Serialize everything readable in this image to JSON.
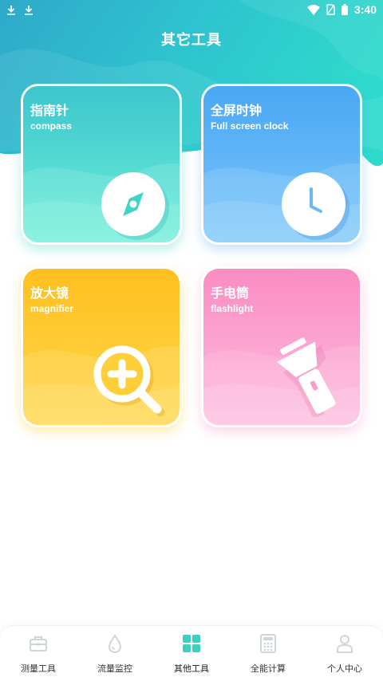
{
  "status_bar": {
    "time": "3:40",
    "left_icons": [
      "download-icon",
      "download-icon"
    ],
    "right_icons": [
      "wifi-icon",
      "no-sim-icon",
      "battery-icon"
    ]
  },
  "header": {
    "title": "其它工具"
  },
  "colors": {
    "teal": "#3fd6c8",
    "blue": "#58b3f5",
    "yellow": "#ffc52a",
    "pink": "#fb96c8",
    "active_nav": "#3ccfc2",
    "inactive_nav": "#cfd6da"
  },
  "tools": [
    {
      "title": "指南针",
      "subtitle": "compass",
      "icon": "compass-icon"
    },
    {
      "title": "全屏时钟",
      "subtitle": "Full screen clock",
      "icon": "clock-icon"
    },
    {
      "title": "放大镜",
      "subtitle": "magnifier",
      "icon": "magnifier-icon"
    },
    {
      "title": "手电筒",
      "subtitle": "flashlight",
      "icon": "flashlight-icon"
    }
  ],
  "bottom_nav": {
    "active_index": 2,
    "items": [
      {
        "label": "测量工具",
        "icon": "toolbox-icon"
      },
      {
        "label": "流量监控",
        "icon": "water-drop-icon"
      },
      {
        "label": "其他工具",
        "icon": "grid-icon"
      },
      {
        "label": "全能计算",
        "icon": "calculator-icon"
      },
      {
        "label": "个人中心",
        "icon": "person-icon"
      }
    ]
  }
}
